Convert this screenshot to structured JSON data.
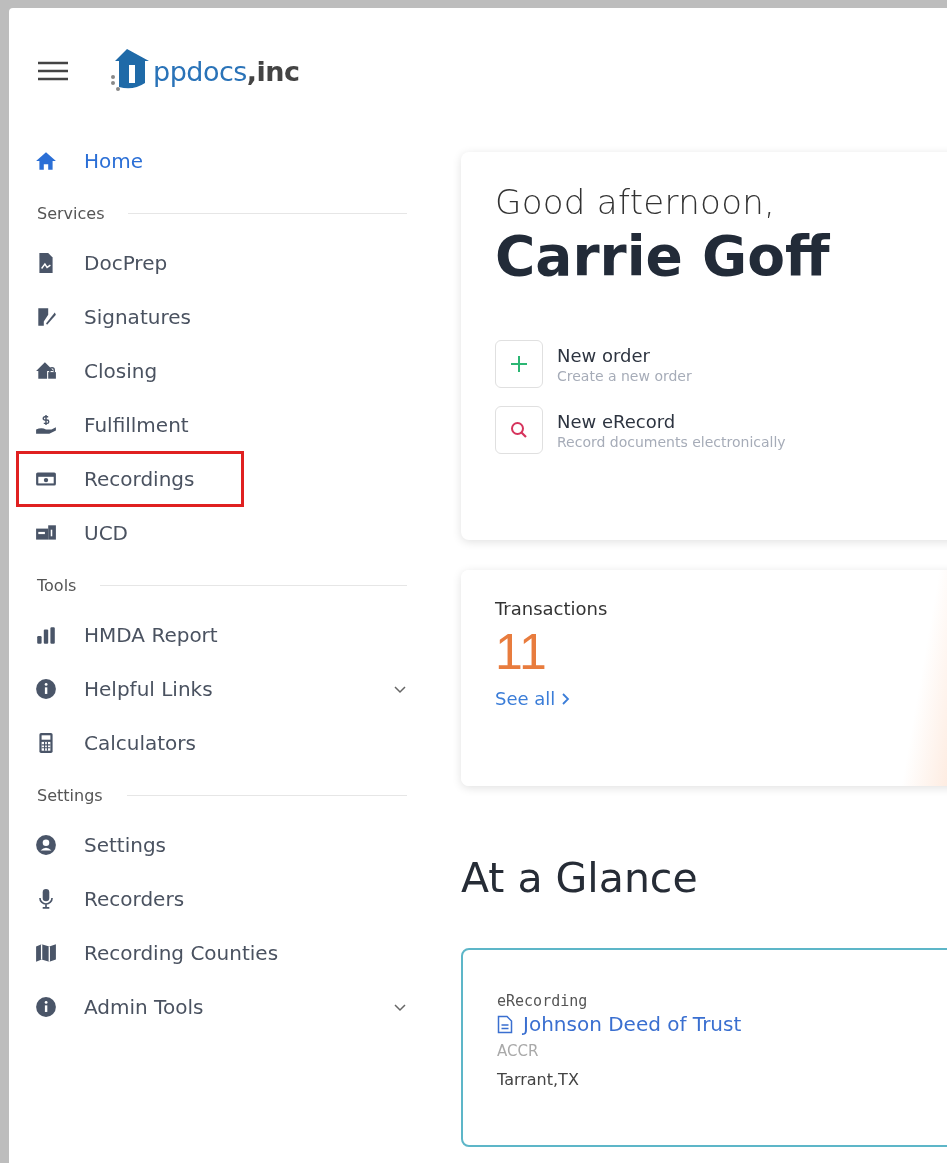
{
  "logo": {
    "text": "ppdocs**,inc**"
  },
  "sidebar": {
    "items": [
      {
        "kind": "link",
        "label": "Home",
        "selected": true,
        "highlighted": false,
        "expandable": false
      },
      {
        "kind": "section",
        "label": "Services"
      },
      {
        "kind": "link",
        "label": "DocPrep",
        "selected": false,
        "highlighted": false,
        "expandable": false
      },
      {
        "kind": "link",
        "label": "Signatures",
        "selected": false,
        "highlighted": false,
        "expandable": false
      },
      {
        "kind": "link",
        "label": "Closing",
        "selected": false,
        "highlighted": false,
        "expandable": false
      },
      {
        "kind": "link",
        "label": "Fulfillment",
        "selected": false,
        "highlighted": false,
        "expandable": false
      },
      {
        "kind": "link",
        "label": "Recordings",
        "selected": false,
        "highlighted": true,
        "expandable": false
      },
      {
        "kind": "link",
        "label": "UCD",
        "selected": false,
        "highlighted": false,
        "expandable": false
      },
      {
        "kind": "section",
        "label": "Tools"
      },
      {
        "kind": "link",
        "label": "HMDA Report",
        "selected": false,
        "highlighted": false,
        "expandable": false
      },
      {
        "kind": "link",
        "label": "Helpful Links",
        "selected": false,
        "highlighted": false,
        "expandable": true
      },
      {
        "kind": "link",
        "label": "Calculators",
        "selected": false,
        "highlighted": false,
        "expandable": false
      },
      {
        "kind": "section",
        "label": "Settings"
      },
      {
        "kind": "link",
        "label": "Settings",
        "selected": false,
        "highlighted": false,
        "expandable": false
      },
      {
        "kind": "link",
        "label": "Recorders",
        "selected": false,
        "highlighted": false,
        "expandable": false
      },
      {
        "kind": "link",
        "label": "Recording Counties",
        "selected": false,
        "highlighted": false,
        "expandable": false
      },
      {
        "kind": "link",
        "label": "Admin Tools",
        "selected": false,
        "highlighted": false,
        "expandable": true
      }
    ]
  },
  "greeting": {
    "salutation": "Good afternoon,",
    "name": "Carrie Goff",
    "actions": [
      {
        "kind": "add",
        "title": "New order",
        "subtitle": "Create a new order"
      },
      {
        "kind": "search",
        "title": "New eRecord",
        "subtitle": "Record documents electronically"
      }
    ]
  },
  "transactions": {
    "title": "Transactions",
    "count": "11",
    "link": "See all"
  },
  "at_a_glance": {
    "heading": "At a Glance",
    "cards": [
      {
        "type": "eRecording",
        "title": "Johnson Deed of Trust",
        "code": "ACCR",
        "location": "Tarrant,TX"
      }
    ]
  }
}
